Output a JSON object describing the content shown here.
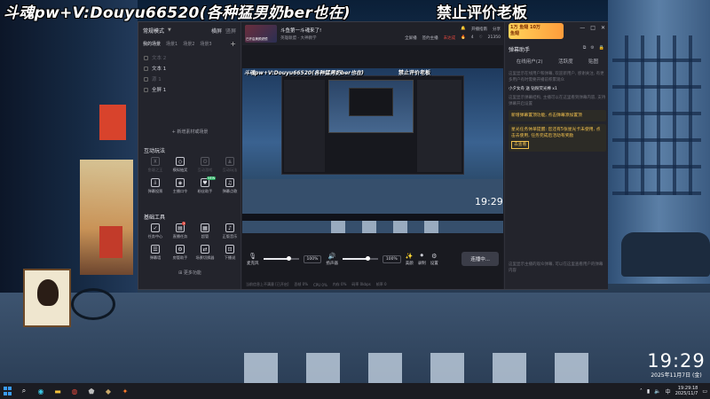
{
  "overlay": {
    "left_text": "斗魂pw+V:Douyu66520(各种猛男奶ber也在)",
    "right_text": "禁止评价老板"
  },
  "desktop_clock": {
    "time": "19:29",
    "date": "2025年11月7日 (金)"
  },
  "sidebar": {
    "mode": "常规模式",
    "header_right_1": "横屏",
    "header_right_2": "竖屏",
    "tabs": [
      "我的场景",
      "场景1",
      "场景2",
      "场景3"
    ],
    "scenes": [
      {
        "label": "文本 2",
        "dim": true
      },
      {
        "label": "文本 1",
        "dim": false
      },
      {
        "label": "源 1",
        "dim": true
      },
      {
        "label": "全屏 1",
        "dim": false
      }
    ],
    "add_material": "+ 新增素材或场景",
    "interactive_title": "互动玩法",
    "interactive_tools": [
      {
        "label": "鱼塘之王",
        "icon": "♜",
        "dim": true,
        "badge": ""
      },
      {
        "label": "模拟抽奖",
        "icon": "◇",
        "dim": false,
        "badge": ""
      },
      {
        "label": "互动游戏",
        "icon": "✪",
        "dim": true,
        "badge": ""
      },
      {
        "label": "互动玩法",
        "icon": "♟",
        "dim": true,
        "badge": ""
      },
      {
        "label": "弹幕投票",
        "icon": "⇩",
        "dim": false,
        "badge": ""
      },
      {
        "label": "主播口令",
        "icon": "◈",
        "dim": false,
        "badge": ""
      },
      {
        "label": "粉丝助手",
        "icon": "♥",
        "dim": false,
        "badge": "NEW"
      },
      {
        "label": "弹幕点歌",
        "icon": "♫",
        "dim": false,
        "badge": ""
      }
    ],
    "basic_title": "基础工具",
    "basic_tools": [
      {
        "label": "任务中心",
        "icon": "✓",
        "dim": false,
        "badge": ""
      },
      {
        "label": "直播任务",
        "icon": "▤",
        "dim": false,
        "badge": "1"
      },
      {
        "label": "超管",
        "icon": "▦",
        "dim": false,
        "badge": ""
      },
      {
        "label": "正版音乐",
        "icon": "♪",
        "dim": false,
        "badge": ""
      },
      {
        "label": "弹幕墙",
        "icon": "☰",
        "dim": false,
        "badge": ""
      },
      {
        "label": "房管助手",
        "icon": "⚙",
        "dim": false,
        "badge": ""
      },
      {
        "label": "场景切换器",
        "icon": "⇄",
        "dim": false,
        "badge": ""
      },
      {
        "label": "下播说",
        "icon": "⊡",
        "dim": false,
        "badge": ""
      }
    ],
    "more_features": "更多功能"
  },
  "main": {
    "live_thumb_label": "已开启美颜滤镜",
    "title": "斗鱼第一斗魂来了!",
    "subtitle": "英雄联盟 - 大神教学",
    "row1": [
      "开播指南",
      "分享"
    ],
    "row2": [
      "全屏播",
      "签约主播",
      "未达成",
      "4",
      "21350"
    ],
    "preview": {
      "ov_left": "斗魂pw+V:Douyu66520(各种猛男奶ber也在)",
      "ov_right": "禁止评价老板",
      "clock": "19:29"
    },
    "controls": {
      "mic_label": "麦克风",
      "mic_pct": "100%",
      "speaker_label": "扬声器",
      "speaker_pct": "100%",
      "beauty_label": "美颜",
      "record_label": "录制",
      "settings_label": "设置",
      "stream_button": "连播中...",
      "mic_level": 0.7,
      "speaker_level": 0.7
    },
    "status": [
      "当前信息上不满意 [已开启]",
      "丢帧 0%",
      "CPU 0%",
      "内存 0%",
      "码率 0kbps",
      "帧率 0"
    ]
  },
  "rpanel": {
    "ad_line1": "1万 鱼翅 10万",
    "ad_line2": "鱼翅",
    "title": "弹幕助手",
    "tabs": [
      "在线用户(2)",
      "活跃度",
      "贴图"
    ],
    "body1": "这里显示在线用户和弹幕, 欢迎新用户, 感谢关注, 有更多用户有时需要开播前积累观众",
    "body2": "小夕女舟 送 钻粉荧光棒 x1",
    "body3": "这里显示弹幕结构, 主播可以在这里看到弹幕内容, 支持弹幕开启设置",
    "notice": "新增弹幕置顶功能, 点击弹幕添加置顶",
    "notice2": "星光任务休单提醒: 您还有5张星光卡未使用, 点击去使用, 任务完成后活动有奖励",
    "notice_btn": "去查看",
    "bottom": "这里显示主播的观众弹幕, 可以在这里查看用户的弹幕内容"
  },
  "taskbar": {
    "tray_time": "19:29:18",
    "tray_date": "2025/11/7",
    "tray_lang": "中"
  }
}
